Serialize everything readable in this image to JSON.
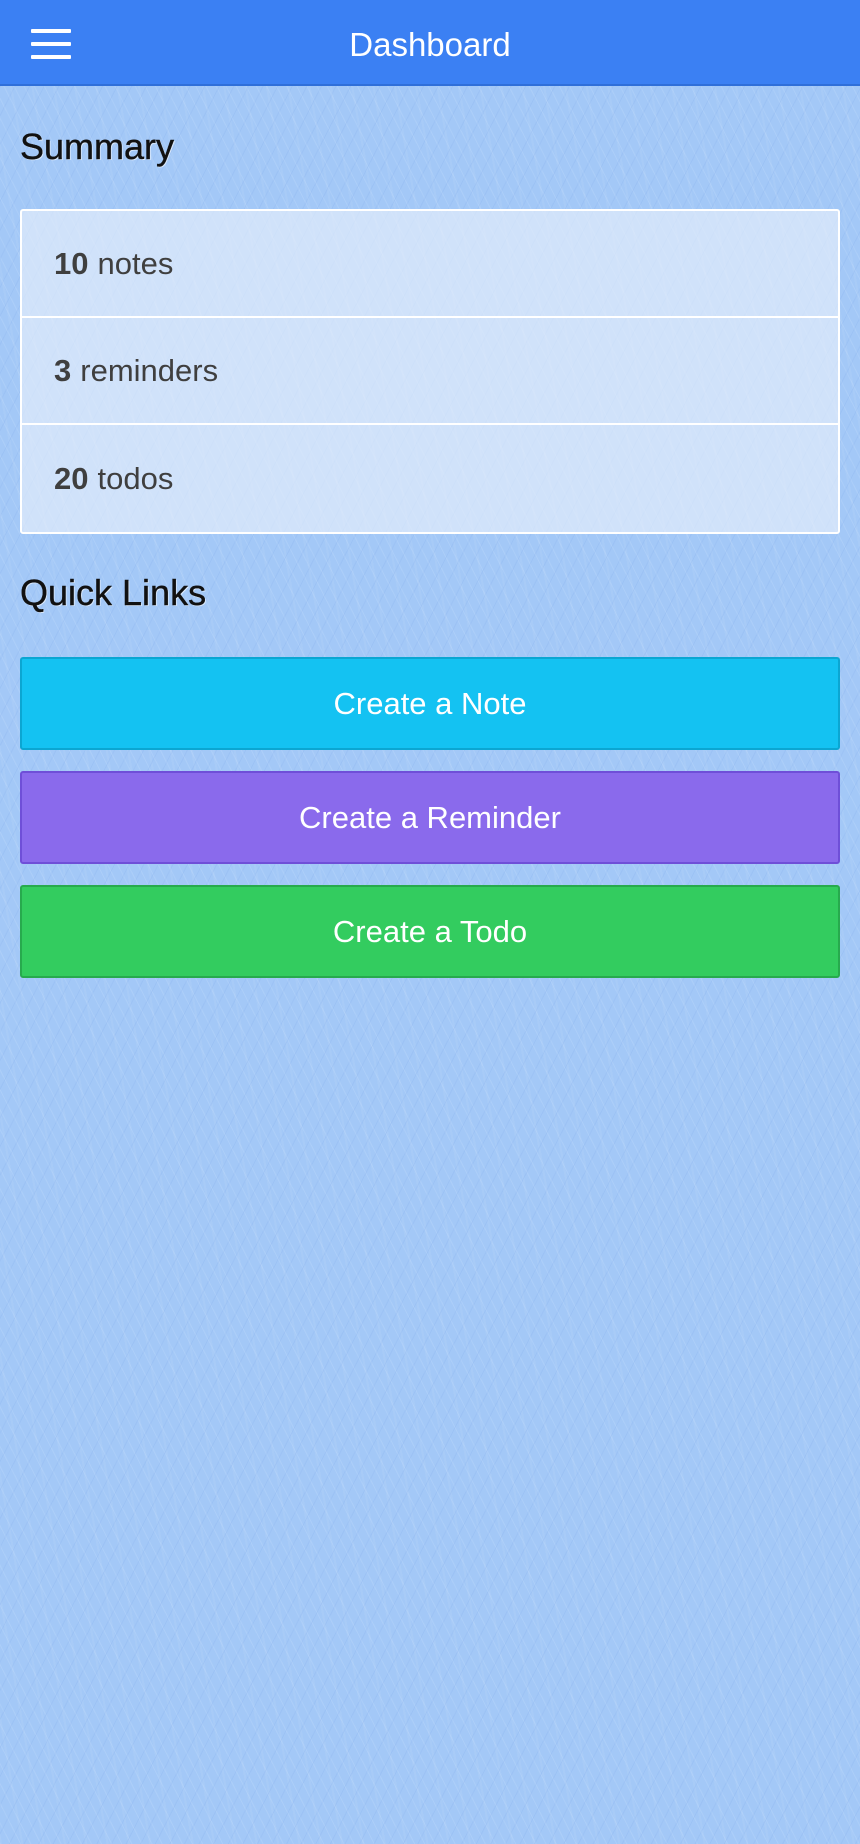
{
  "navbar": {
    "title": "Dashboard",
    "menu_icon": "hamburger-menu-icon",
    "background_color": "#3b80f3"
  },
  "summary": {
    "heading": "Summary",
    "items": [
      {
        "count": "10",
        "label": "notes"
      },
      {
        "count": "3",
        "label": "reminders"
      },
      {
        "count": "20",
        "label": "todos"
      }
    ]
  },
  "quick_links": {
    "heading": "Quick Links",
    "buttons": [
      {
        "label": "Create a Note",
        "color": "#14c2f2"
      },
      {
        "label": "Create a Reminder",
        "color": "#8a6aec"
      },
      {
        "label": "Create a Todo",
        "color": "#33cc5f"
      }
    ]
  }
}
